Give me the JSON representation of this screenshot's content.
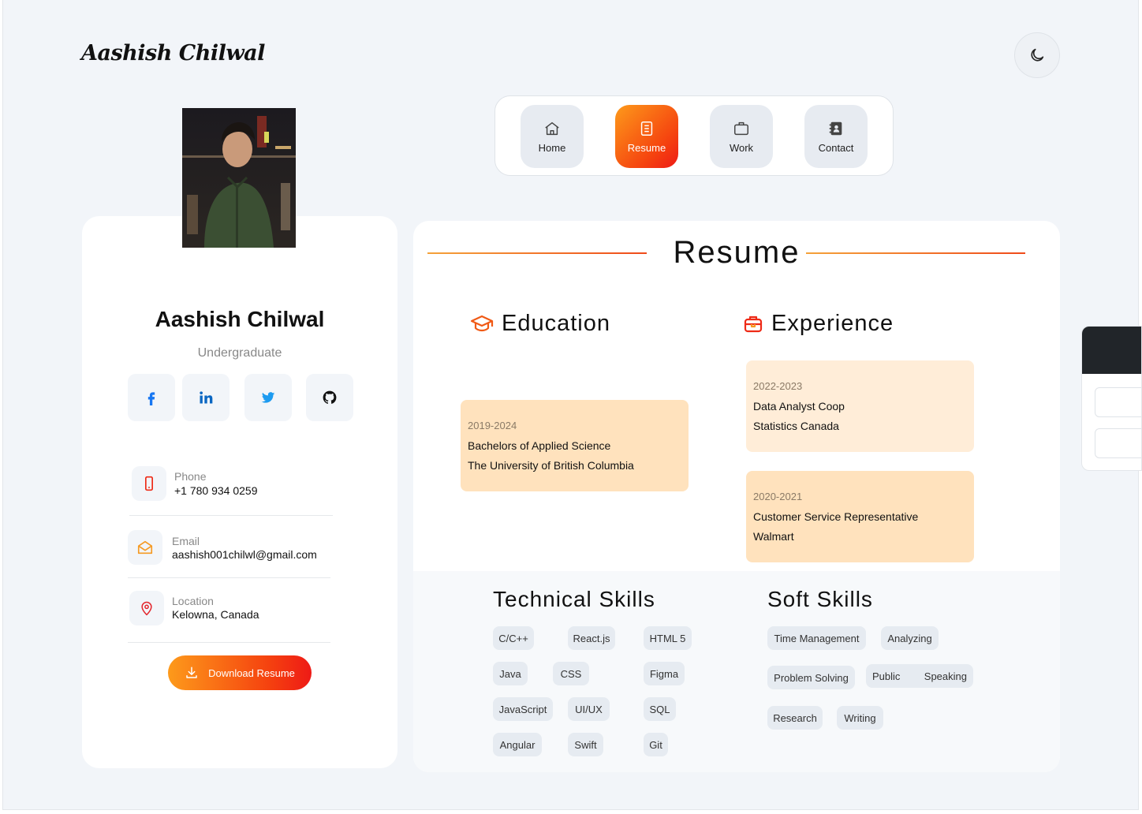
{
  "brand": {
    "logo": "Aashish Chilwal"
  },
  "theme_toggle": {
    "icon": "moon-icon"
  },
  "nav": {
    "items": [
      {
        "label": "Home",
        "icon": "home-icon"
      },
      {
        "label": "Resume",
        "icon": "document-icon",
        "active": true
      },
      {
        "label": "Work",
        "icon": "briefcase-icon"
      },
      {
        "label": "Contact",
        "icon": "contact-book-icon"
      }
    ]
  },
  "profile": {
    "name": "Aashish Chilwal",
    "role": "Undergraduate",
    "socials": [
      {
        "name": "facebook",
        "icon": "facebook-icon",
        "color": "#1877f2"
      },
      {
        "name": "linkedin",
        "icon": "linkedin-icon",
        "color": "#0a66c2"
      },
      {
        "name": "twitter",
        "icon": "twitter-icon",
        "color": "#1d9bf0"
      },
      {
        "name": "github",
        "icon": "github-icon",
        "color": "#111111"
      }
    ],
    "contact": {
      "phone_label": "Phone",
      "phone_value": "+1 780 934 0259",
      "email_label": "Email",
      "email_value": "aashish001chilwl@gmail.com",
      "location_label": "Location",
      "location_value": "Kelowna, Canada"
    },
    "download_label": "Download Resume"
  },
  "resume": {
    "title": "Resume",
    "education": {
      "heading": "Education",
      "items": [
        {
          "date": "2019-2024",
          "title": "Bachelors of Applied Science",
          "place": "The University of British Columbia"
        }
      ]
    },
    "experience": {
      "heading": "Experience",
      "items": [
        {
          "date": "2022-2023",
          "title": "Data Analyst Coop",
          "place": "Statistics Canada"
        },
        {
          "date": "2020-2021",
          "title": "Customer Service Representative",
          "place": "Walmart"
        }
      ]
    },
    "technical_skills": {
      "heading": "Technical Skills",
      "tags": [
        "C/C++",
        "React.js",
        "HTML 5",
        "Java",
        "CSS",
        "Figma",
        "JavaScript",
        "UI/UX",
        "SQL",
        "Angular",
        "Swift",
        "Git"
      ]
    },
    "soft_skills": {
      "heading": "Soft Skills",
      "tags": [
        "Time Management",
        "Analyzing",
        "Problem Solving",
        "Public",
        "Speaking",
        "Research",
        "Writing"
      ]
    }
  },
  "colors": {
    "accent_start": "#fd9a1b",
    "accent_end": "#ee1a16",
    "card_light": "#ffedd8",
    "card_mid": "#ffe2bd"
  }
}
